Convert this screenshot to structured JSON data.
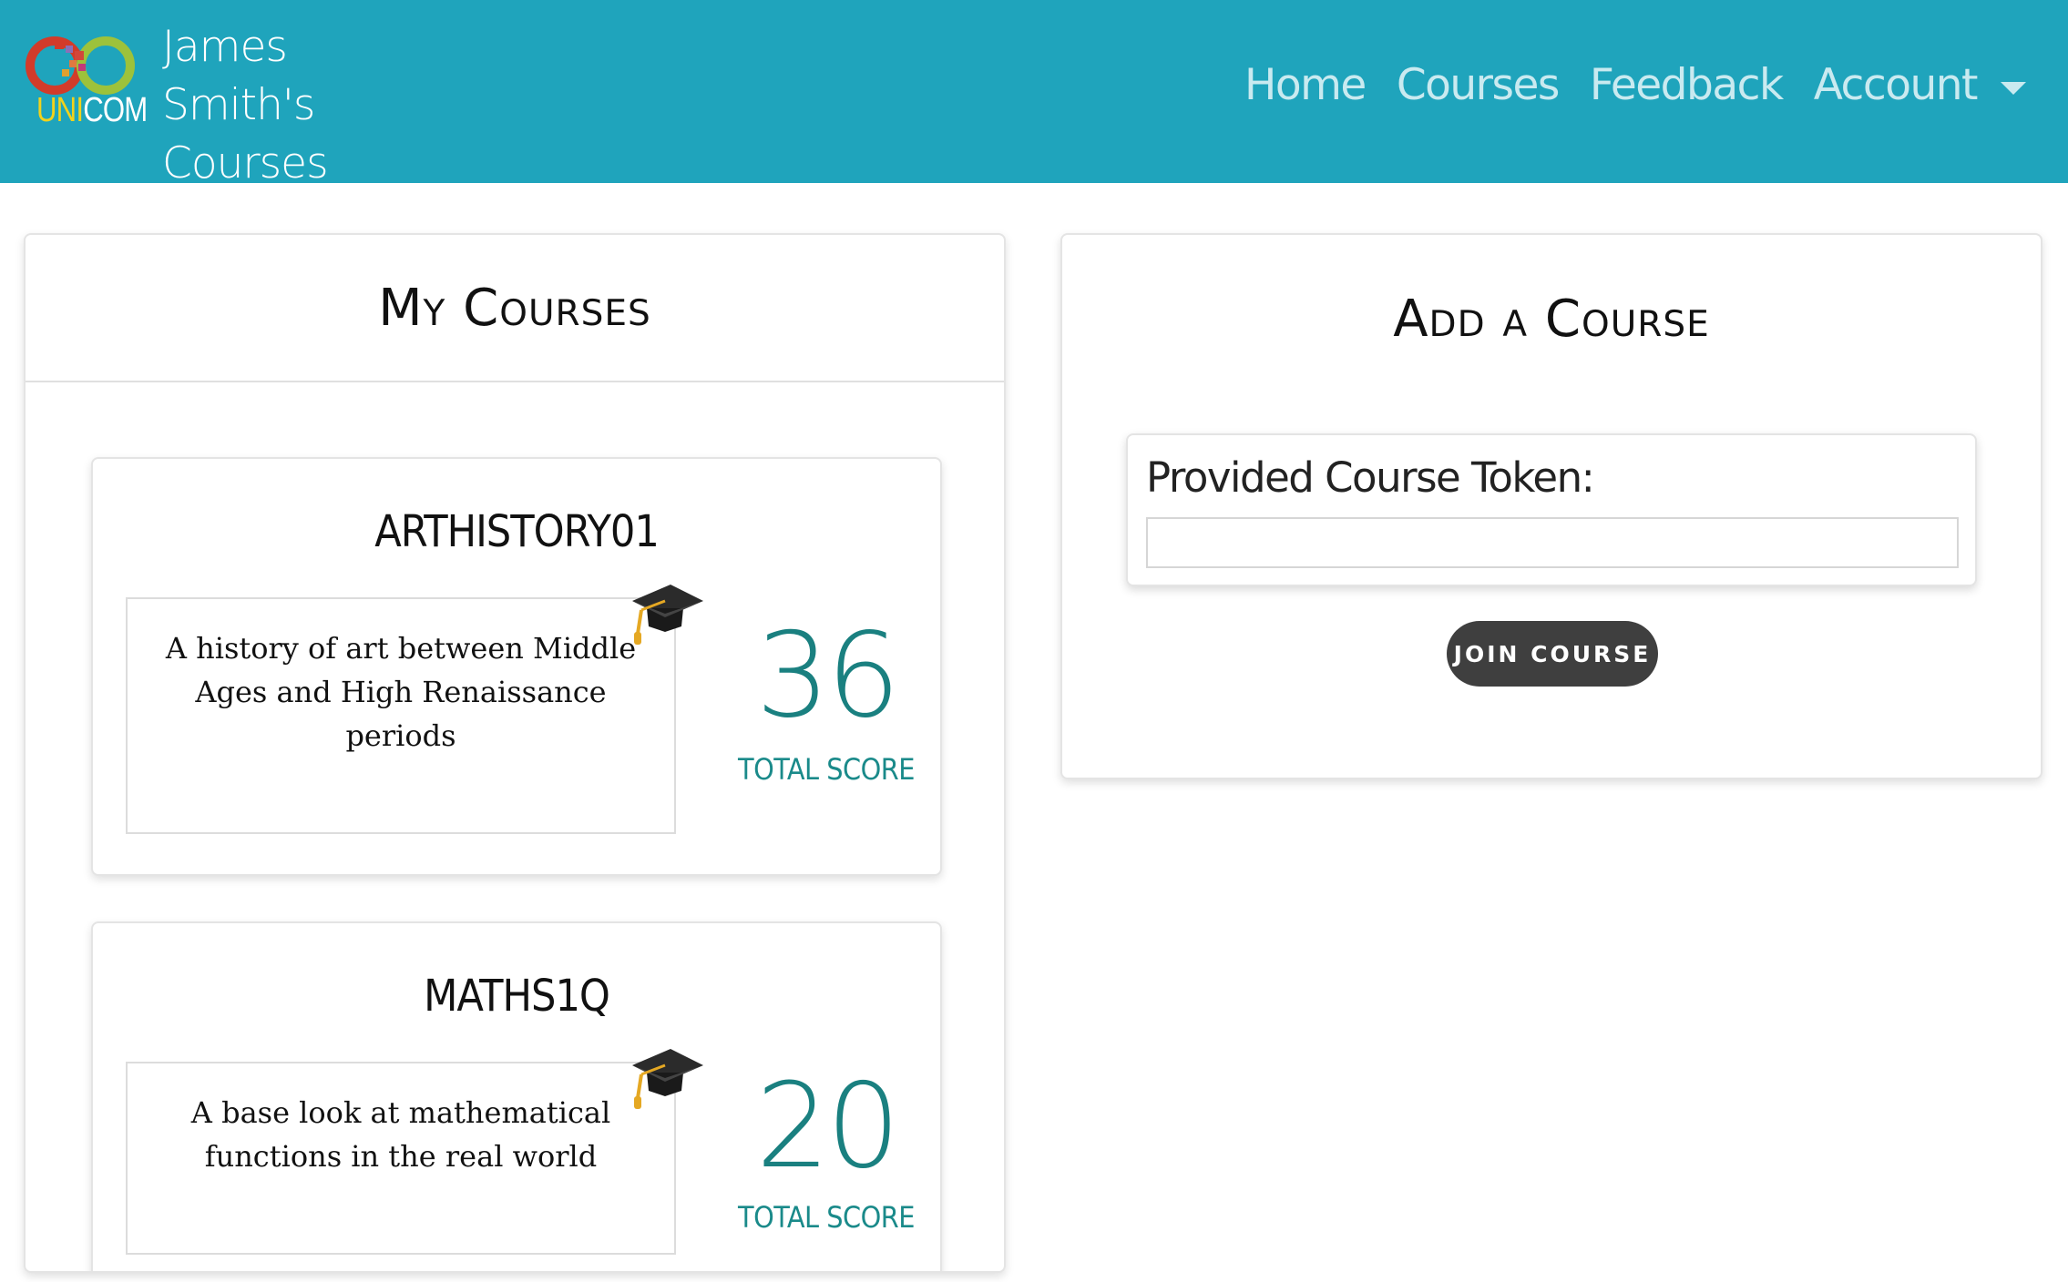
{
  "navbar": {
    "logo": {
      "uni": "UNI",
      "com": "COM"
    },
    "brand": "James Smith's Courses",
    "links": [
      "Home",
      "Courses",
      "Feedback",
      "Account"
    ]
  },
  "my_courses": {
    "title": "My Courses",
    "courses": [
      {
        "name": "ARTHISTORY01",
        "description": "A history of art between Middle Ages and High Renaissance periods",
        "score": "36",
        "score_label": "TOTAL SCORE"
      },
      {
        "name": "MATHS1Q",
        "description": "A base look at mathematical functions in the real world",
        "score": "20",
        "score_label": "TOTAL SCORE"
      }
    ]
  },
  "add_course": {
    "title": "Add a Course",
    "token_label": "Provided Course Token:",
    "token_value": "",
    "join_label": "JOIN COURSE"
  },
  "colors": {
    "navbar": "#1fa4bc",
    "score": "#1a8080",
    "button": "#3f3f3f"
  },
  "icons": [
    "unicom-logo",
    "graduation-cap-icon",
    "chevron-down-icon"
  ]
}
